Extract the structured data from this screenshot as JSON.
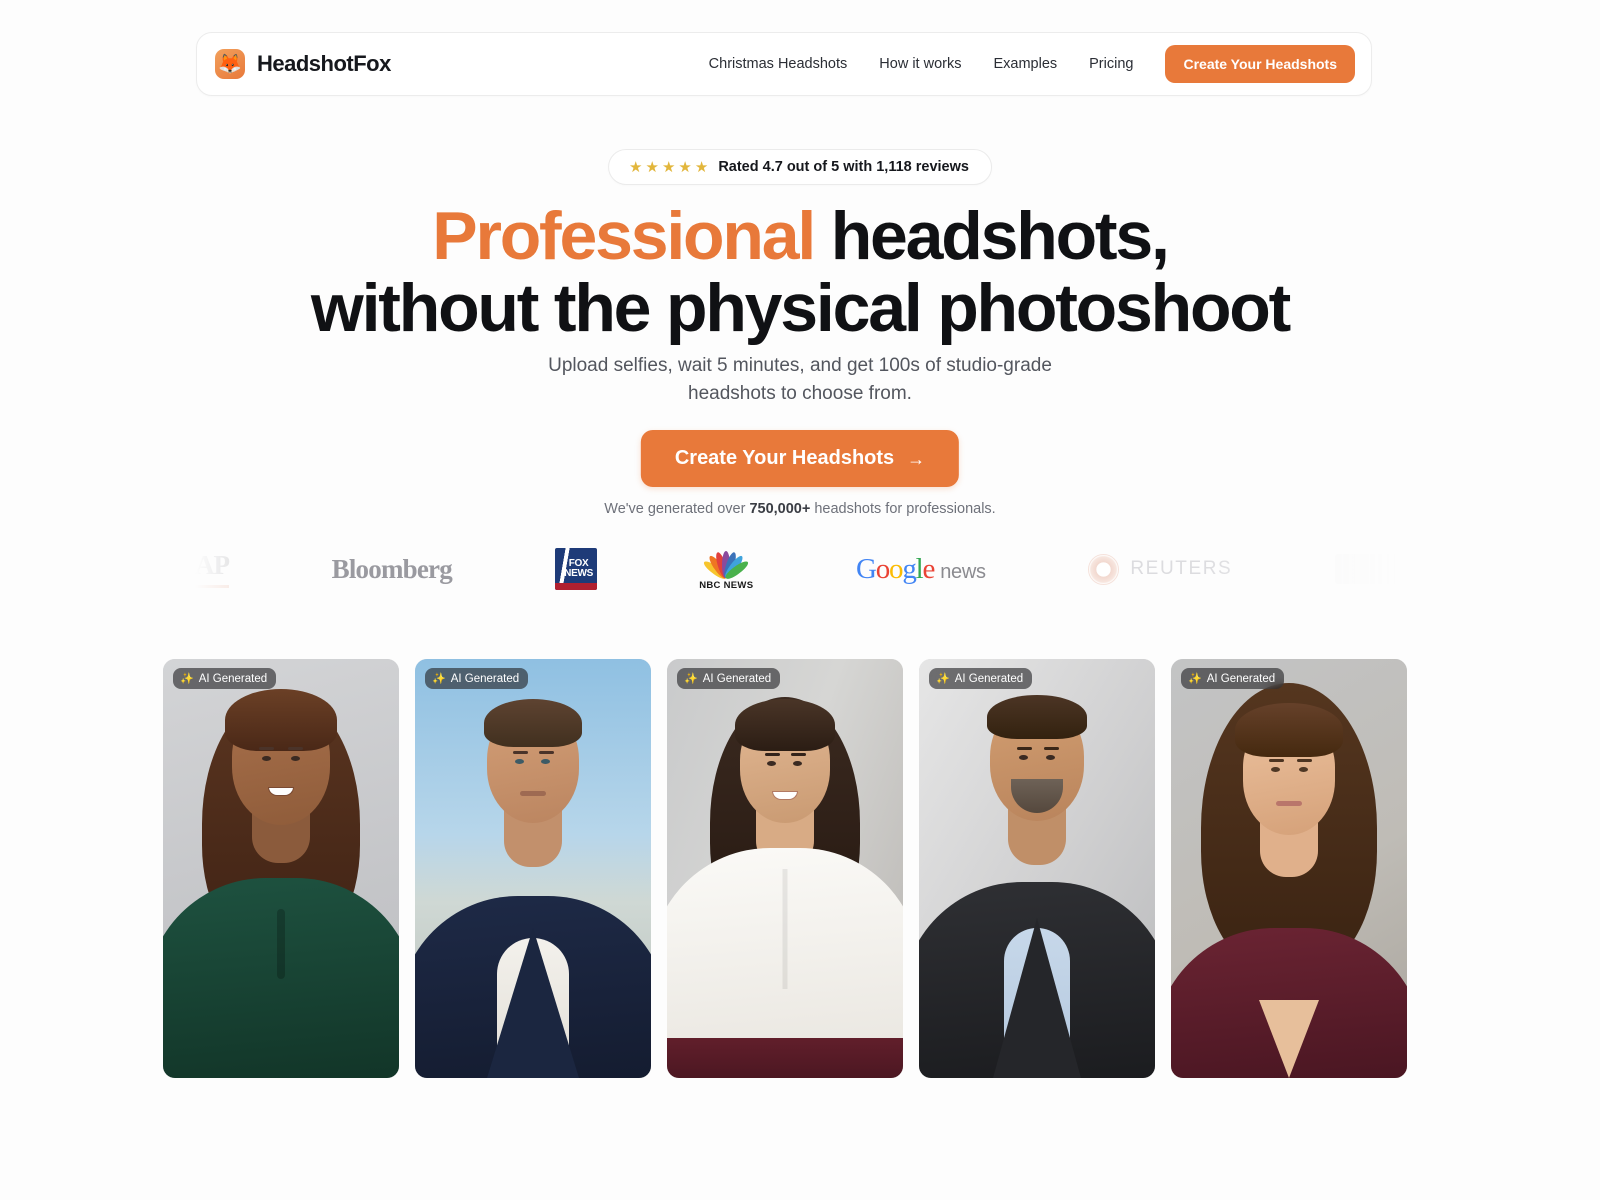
{
  "header": {
    "brand_name": "HeadshotFox",
    "logo_icon": "fox-icon",
    "logo_glyph": "🦊",
    "nav": [
      {
        "label": "Christmas Headshots"
      },
      {
        "label": "How it works"
      },
      {
        "label": "Examples"
      },
      {
        "label": "Pricing"
      }
    ],
    "cta_label": "Create Your Headshots"
  },
  "hero": {
    "rating": {
      "stars": 5,
      "star_glyph": "★",
      "text": "Rated 4.7 out of 5 with 1,118 reviews"
    },
    "headline_accent": "Professional",
    "headline_rest": " headshots,",
    "headline_line2": "without the physical photoshoot",
    "subhead_line1": "Upload selfies, wait 5 minutes, and get 100s of",
    "subhead_line2": "studio-grade headshots to choose from.",
    "cta_label": "Create Your Headshots",
    "cta_arrow": "→",
    "stat_prefix": "We've generated over ",
    "stat_number": "750,000+",
    "stat_suffix": " headshots for professionals."
  },
  "press_logos": [
    {
      "name": "ap-logo",
      "text": "AP"
    },
    {
      "name": "bloomberg-logo",
      "text": "Bloomberg"
    },
    {
      "name": "fox-news-logo",
      "line1": "FOX",
      "line2": "NEWS"
    },
    {
      "name": "nbc-news-logo",
      "text": "NBC NEWS"
    },
    {
      "name": "google-news-logo",
      "g1": "G",
      "g2": "o",
      "g3": "o",
      "g4": "g",
      "g5": "l",
      "g6": "e",
      "news": "news"
    },
    {
      "name": "reuters-logo",
      "text": "REUTERS"
    },
    {
      "name": "partial-logo",
      "text": ""
    }
  ],
  "gallery": {
    "badge_label": "AI Generated",
    "badge_icon": "sparkles-icon",
    "badge_glyph": "✨",
    "cards": [
      {
        "name": "headshot-card-1",
        "alt": "Smiling woman with long curly auburn hair in a dark green blouse on a light grey studio backdrop"
      },
      {
        "name": "headshot-card-2",
        "alt": "Man with short brown hair in a navy suit and white open-collar shirt against a blurred blue sky and city skyline"
      },
      {
        "name": "headshot-card-3",
        "alt": "Smiling woman with long dark wavy hair in a white button-down shirt and burgundy skirt against a grey wall"
      },
      {
        "name": "headshot-card-4",
        "alt": "Bearded man in a charcoal suit, light blue shirt and grey-blue tie, holding his lapel, on a light grey backdrop"
      },
      {
        "name": "headshot-card-5",
        "alt": "Woman with long wavy brown hair in a burgundy V-neck sweater against a soft grey-beige backdrop"
      }
    ]
  },
  "colors": {
    "accent_orange": "#e8793a",
    "star_gold": "#e2b63c",
    "text_dark": "#101114",
    "text_muted": "#6e717a",
    "page_bg": "#fdfdfd"
  }
}
